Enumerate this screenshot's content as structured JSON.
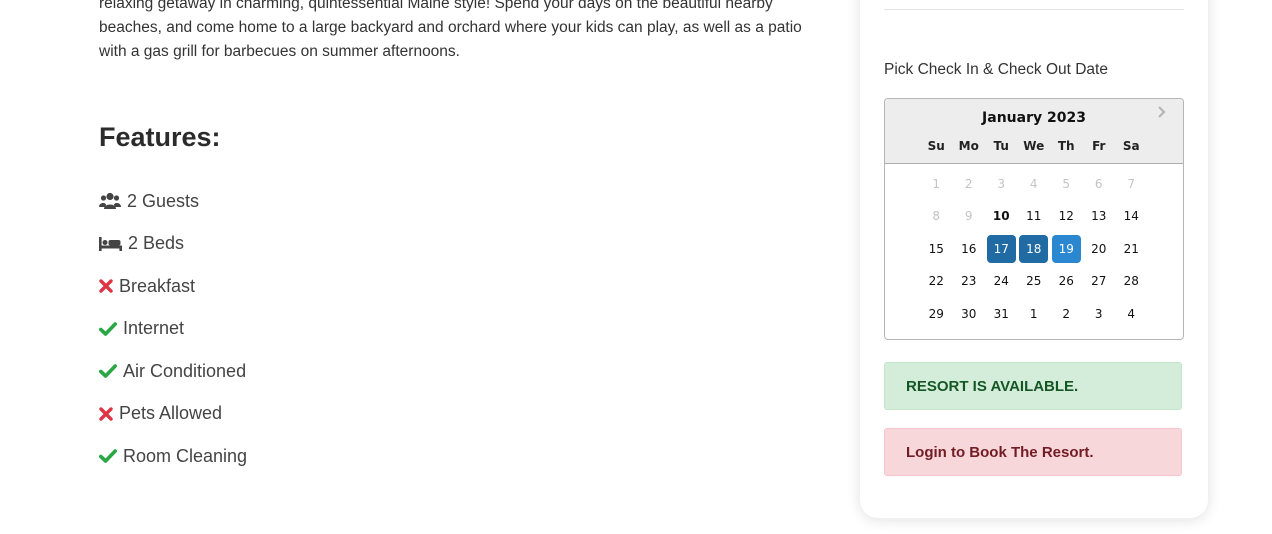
{
  "description": {
    "lines": [
      "relaxing getaway in charming, quintessential Maine style! Spend your days on the beautiful nearby",
      "beaches, and come home to a large backyard and orchard where your kids can play, as well as a patio",
      "with a gas grill for barbecues on summer afternoons."
    ]
  },
  "features": {
    "title": "Features:",
    "items": [
      {
        "icon": "users-icon",
        "label": "2 Guests"
      },
      {
        "icon": "bed-icon",
        "label": "2 Beds"
      },
      {
        "icon": "cross-icon",
        "label": "Breakfast",
        "available": false
      },
      {
        "icon": "check-icon",
        "label": "Internet",
        "available": true
      },
      {
        "icon": "check-icon",
        "label": "Air Conditioned",
        "available": true
      },
      {
        "icon": "cross-icon",
        "label": "Pets Allowed",
        "available": false
      },
      {
        "icon": "check-icon",
        "label": "Room Cleaning",
        "available": true
      }
    ]
  },
  "booking": {
    "date_label": "Pick Check In & Check Out Date",
    "calendar": {
      "month": "January 2023",
      "weekdays": [
        "Su",
        "Mo",
        "Tu",
        "We",
        "Th",
        "Fr",
        "Sa"
      ],
      "weeks": [
        [
          "1",
          "2",
          "3",
          "4",
          "5",
          "6",
          "7"
        ],
        [
          "8",
          "9",
          "10",
          "11",
          "12",
          "13",
          "14"
        ],
        [
          "15",
          "16",
          "17",
          "18",
          "19",
          "20",
          "21"
        ],
        [
          "22",
          "23",
          "24",
          "25",
          "26",
          "27",
          "28"
        ],
        [
          "29",
          "30",
          "31",
          "1",
          "2",
          "3",
          "4"
        ]
      ],
      "disabled_through": 9,
      "today": "10",
      "selected": [
        "17",
        "18",
        "19"
      ]
    },
    "availability_message": "RESORT IS AVAILABLE.",
    "login_message": "Login to Book The Resort."
  },
  "colors": {
    "check": "#28a745",
    "cross": "#dc3545",
    "selected_day": "#216ba5",
    "success_bg": "#d4edda",
    "danger_bg": "#f8d7da"
  }
}
